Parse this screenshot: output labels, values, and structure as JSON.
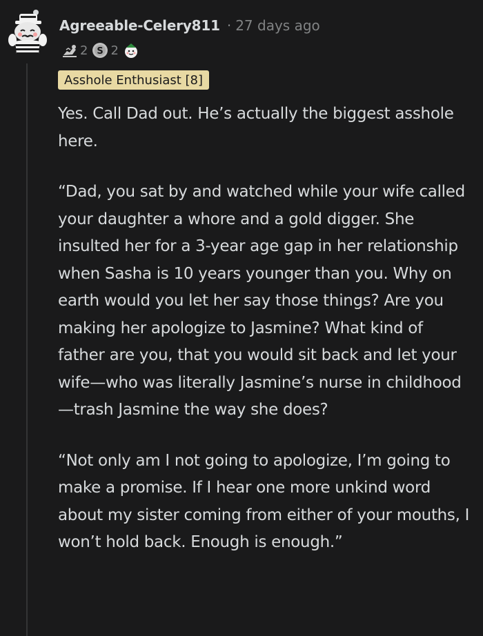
{
  "comment": {
    "username": "Agreeable-Celery811",
    "separator": "·",
    "timestamp": "27 days ago",
    "awards": [
      {
        "icon": "helpful-award-icon",
        "count": "2"
      },
      {
        "icon": "silver-award-icon",
        "count": "2"
      },
      {
        "icon": "wholesome-award-icon",
        "count": ""
      }
    ],
    "flair": "Asshole Enthusiast [8]",
    "paragraphs": [
      "Yes. Call Dad out. He’s actually the biggest asshole here.",
      "“Dad, you sat by and watched while your wife called your daughter a whore and a gold digger. She insulted her for a 3-year age gap in her relationship when Sasha is 10 years younger than you. Why on earth would you let her say those things? Are you making her apologize to Jasmine? What kind of father are you, that you would sit back and let your wife—who was literally Jasmine’s nurse in childhood—trash Jasmine the way she does?",
      "“Not only am I not going to apologize, I’m going to make a promise. If I hear one more unkind word about my sister coming from either of your mouths, I won’t hold back. Enough is enough.”"
    ]
  },
  "colors": {
    "background": "#1a1a1b",
    "text": "#d7dadc",
    "meta": "#818384",
    "flair_bg": "#e8d9a3",
    "thread_line": "#343536"
  }
}
